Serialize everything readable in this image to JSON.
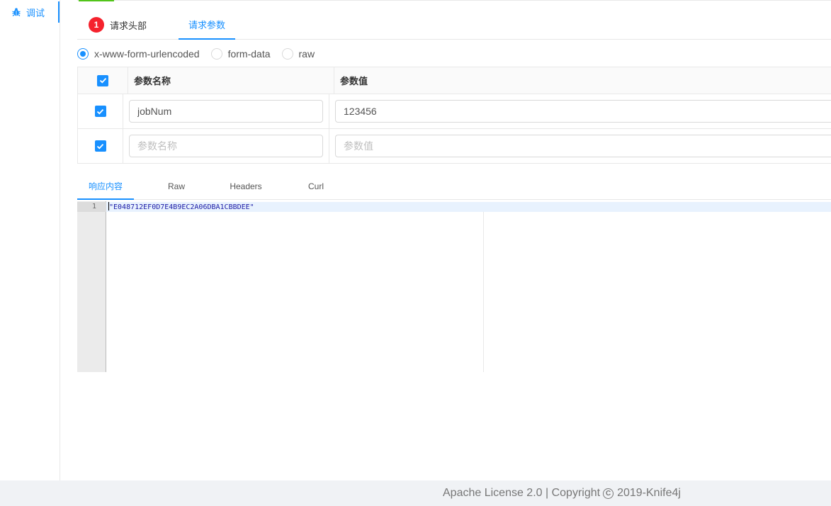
{
  "sidebar": {
    "items": [
      {
        "label": "调试",
        "icon": "bug-icon",
        "active": true
      }
    ]
  },
  "request_tabs": {
    "headers_tab": {
      "label": "请求头部",
      "badge": "1"
    },
    "params_tab": {
      "label": "请求参数",
      "active": true
    }
  },
  "body_types": {
    "options": [
      "x-www-form-urlencoded",
      "form-data",
      "raw"
    ],
    "selected": "x-www-form-urlencoded"
  },
  "params_table": {
    "headers": {
      "name": "参数名称",
      "value": "参数值"
    },
    "rows": [
      {
        "checked": true,
        "name": "jobNum",
        "value": "123456"
      },
      {
        "checked": true,
        "name": "",
        "value": "",
        "name_placeholder": "参数名称",
        "value_placeholder": "参数值"
      }
    ]
  },
  "response_tabs": {
    "tabs": [
      "响应内容",
      "Raw",
      "Headers",
      "Curl"
    ],
    "active": "响应内容"
  },
  "editor": {
    "line_number": "1",
    "content": "\"E048712EF0D7E4B9EC2A06DBA1CBBDEE\""
  },
  "footer": {
    "text_before": "Apache License 2.0 | Copyright",
    "symbol": "C",
    "text_after": "2019-Knife4j"
  },
  "colors": {
    "accent": "#1890ff",
    "badge": "#f5222d",
    "footer_bg": "#f0f2f5"
  }
}
